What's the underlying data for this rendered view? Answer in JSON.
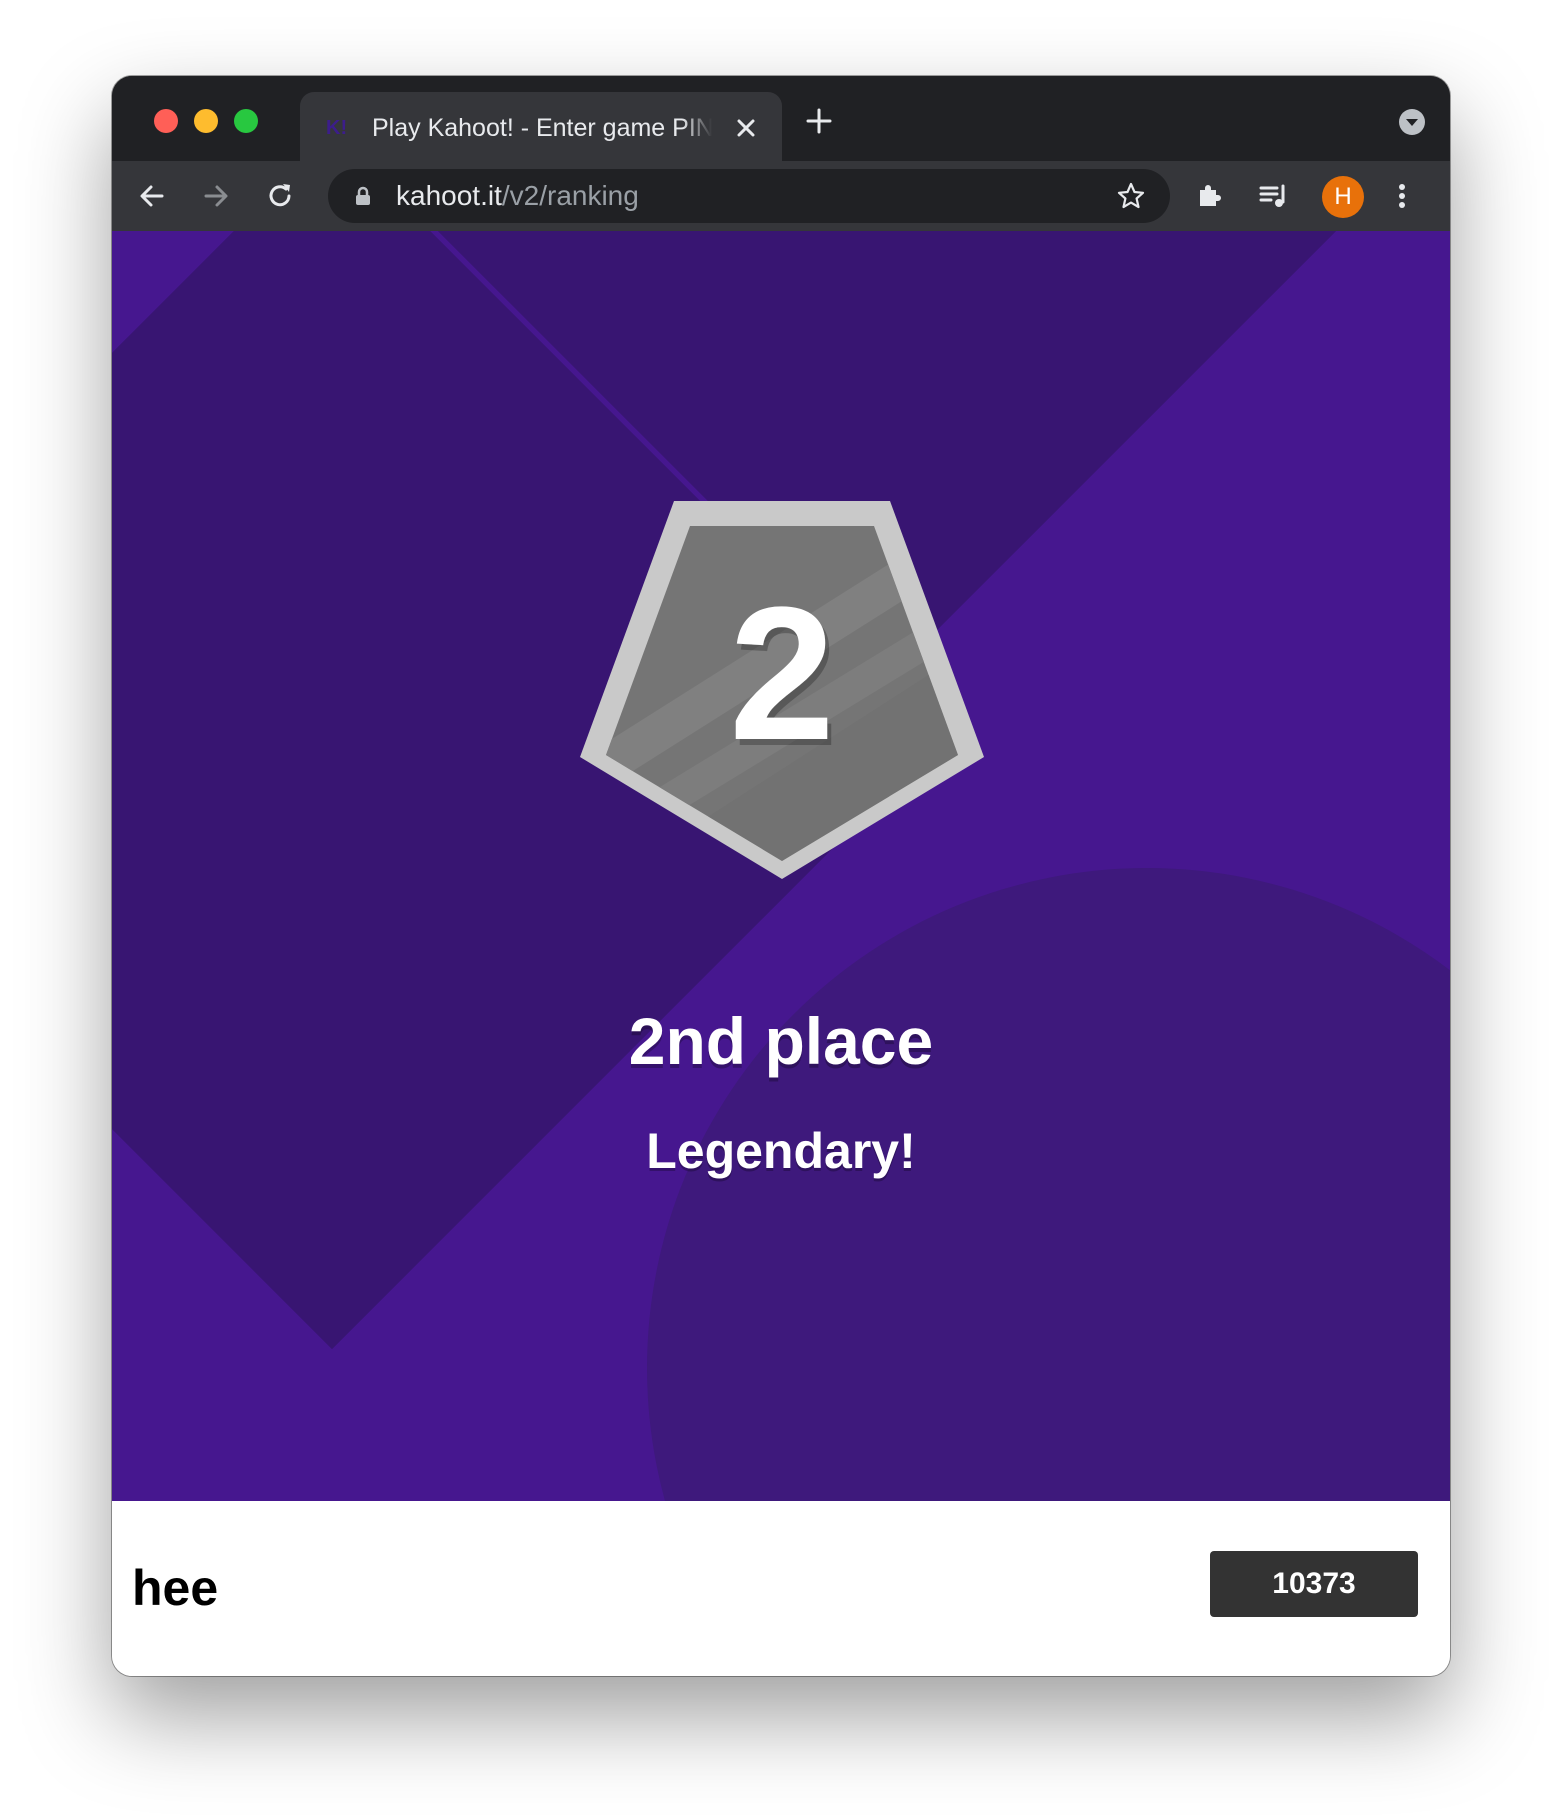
{
  "browser": {
    "tab": {
      "favicon": "kahoot-favicon",
      "title": "Play Kahoot! - Enter game PIN here!"
    },
    "address_bar": {
      "host": "kahoot.it",
      "path": "/v2/ranking"
    },
    "profile_initial": "H",
    "icons": [
      "back-icon",
      "forward-icon",
      "reload-icon",
      "lock-icon",
      "star-icon",
      "extensions-icon",
      "reading-list-icon",
      "menu-icon",
      "close-icon",
      "plus-icon",
      "chevron-down-icon"
    ]
  },
  "ranking": {
    "rank_number": "2",
    "place_text": "2nd place",
    "praise_text": "Legendary!"
  },
  "player": {
    "nickname": "hee",
    "score": "10373"
  },
  "colors": {
    "stage_background": "#46178f",
    "badge_silver": "#cccccc",
    "badge_face": "#777777",
    "score_box": "#333333"
  }
}
